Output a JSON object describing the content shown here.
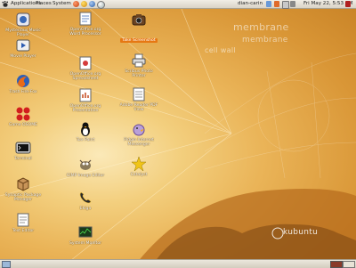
{
  "top_panel": {
    "menus": [
      "Applications",
      "Places",
      "System"
    ],
    "user": "dian-carin",
    "clock": "Fri May 22,  5:53 AM"
  },
  "wallpaper": {
    "text_a": "membrane",
    "text_b": "membrane",
    "text_c": "cell wall",
    "logo": "kubuntu"
  },
  "desktop_icons": [
    {
      "label": "Mysterious Music Player",
      "icon": "music-player-icon"
    },
    {
      "label": "Movie Player",
      "icon": "movie-player-icon"
    },
    {
      "label": "Trash Fire-Fox",
      "icon": "firefox-icon"
    },
    {
      "label": "Game OSOME",
      "icon": "game-icon"
    },
    {
      "label": "Terminal",
      "icon": "terminal-icon"
    },
    {
      "label": "Synaptic Package Manager",
      "icon": "package-manager-icon"
    },
    {
      "label": "Text Editor",
      "icon": "text-editor-icon"
    },
    {
      "label": "OpenOffice.org Word Processor",
      "icon": "word-processor-icon"
    },
    {
      "label": "OpenOffice.org Spreadsheet",
      "icon": "spreadsheet-icon"
    },
    {
      "label": "OpenOffice.org Presentation",
      "icon": "presentation-icon"
    },
    {
      "label": "Tux Paint",
      "icon": "tux-icon"
    },
    {
      "label": "GIMP Image Editor",
      "icon": "gimp-icon"
    },
    {
      "label": "Ekiga",
      "icon": "phone-icon"
    },
    {
      "label": "System Monitor",
      "icon": "system-monitor-icon"
    },
    {
      "label": "Take Screenshot",
      "icon": "camera-icon"
    },
    {
      "label": "Scribus Photo Printer",
      "icon": "printer-icon"
    },
    {
      "label": "Adobe Reader PDF View",
      "icon": "pdf-icon"
    },
    {
      "label": "Pidgin Internet Messenger",
      "icon": "messenger-icon"
    },
    {
      "label": "Catalyst",
      "icon": "catalyst-icon"
    }
  ]
}
